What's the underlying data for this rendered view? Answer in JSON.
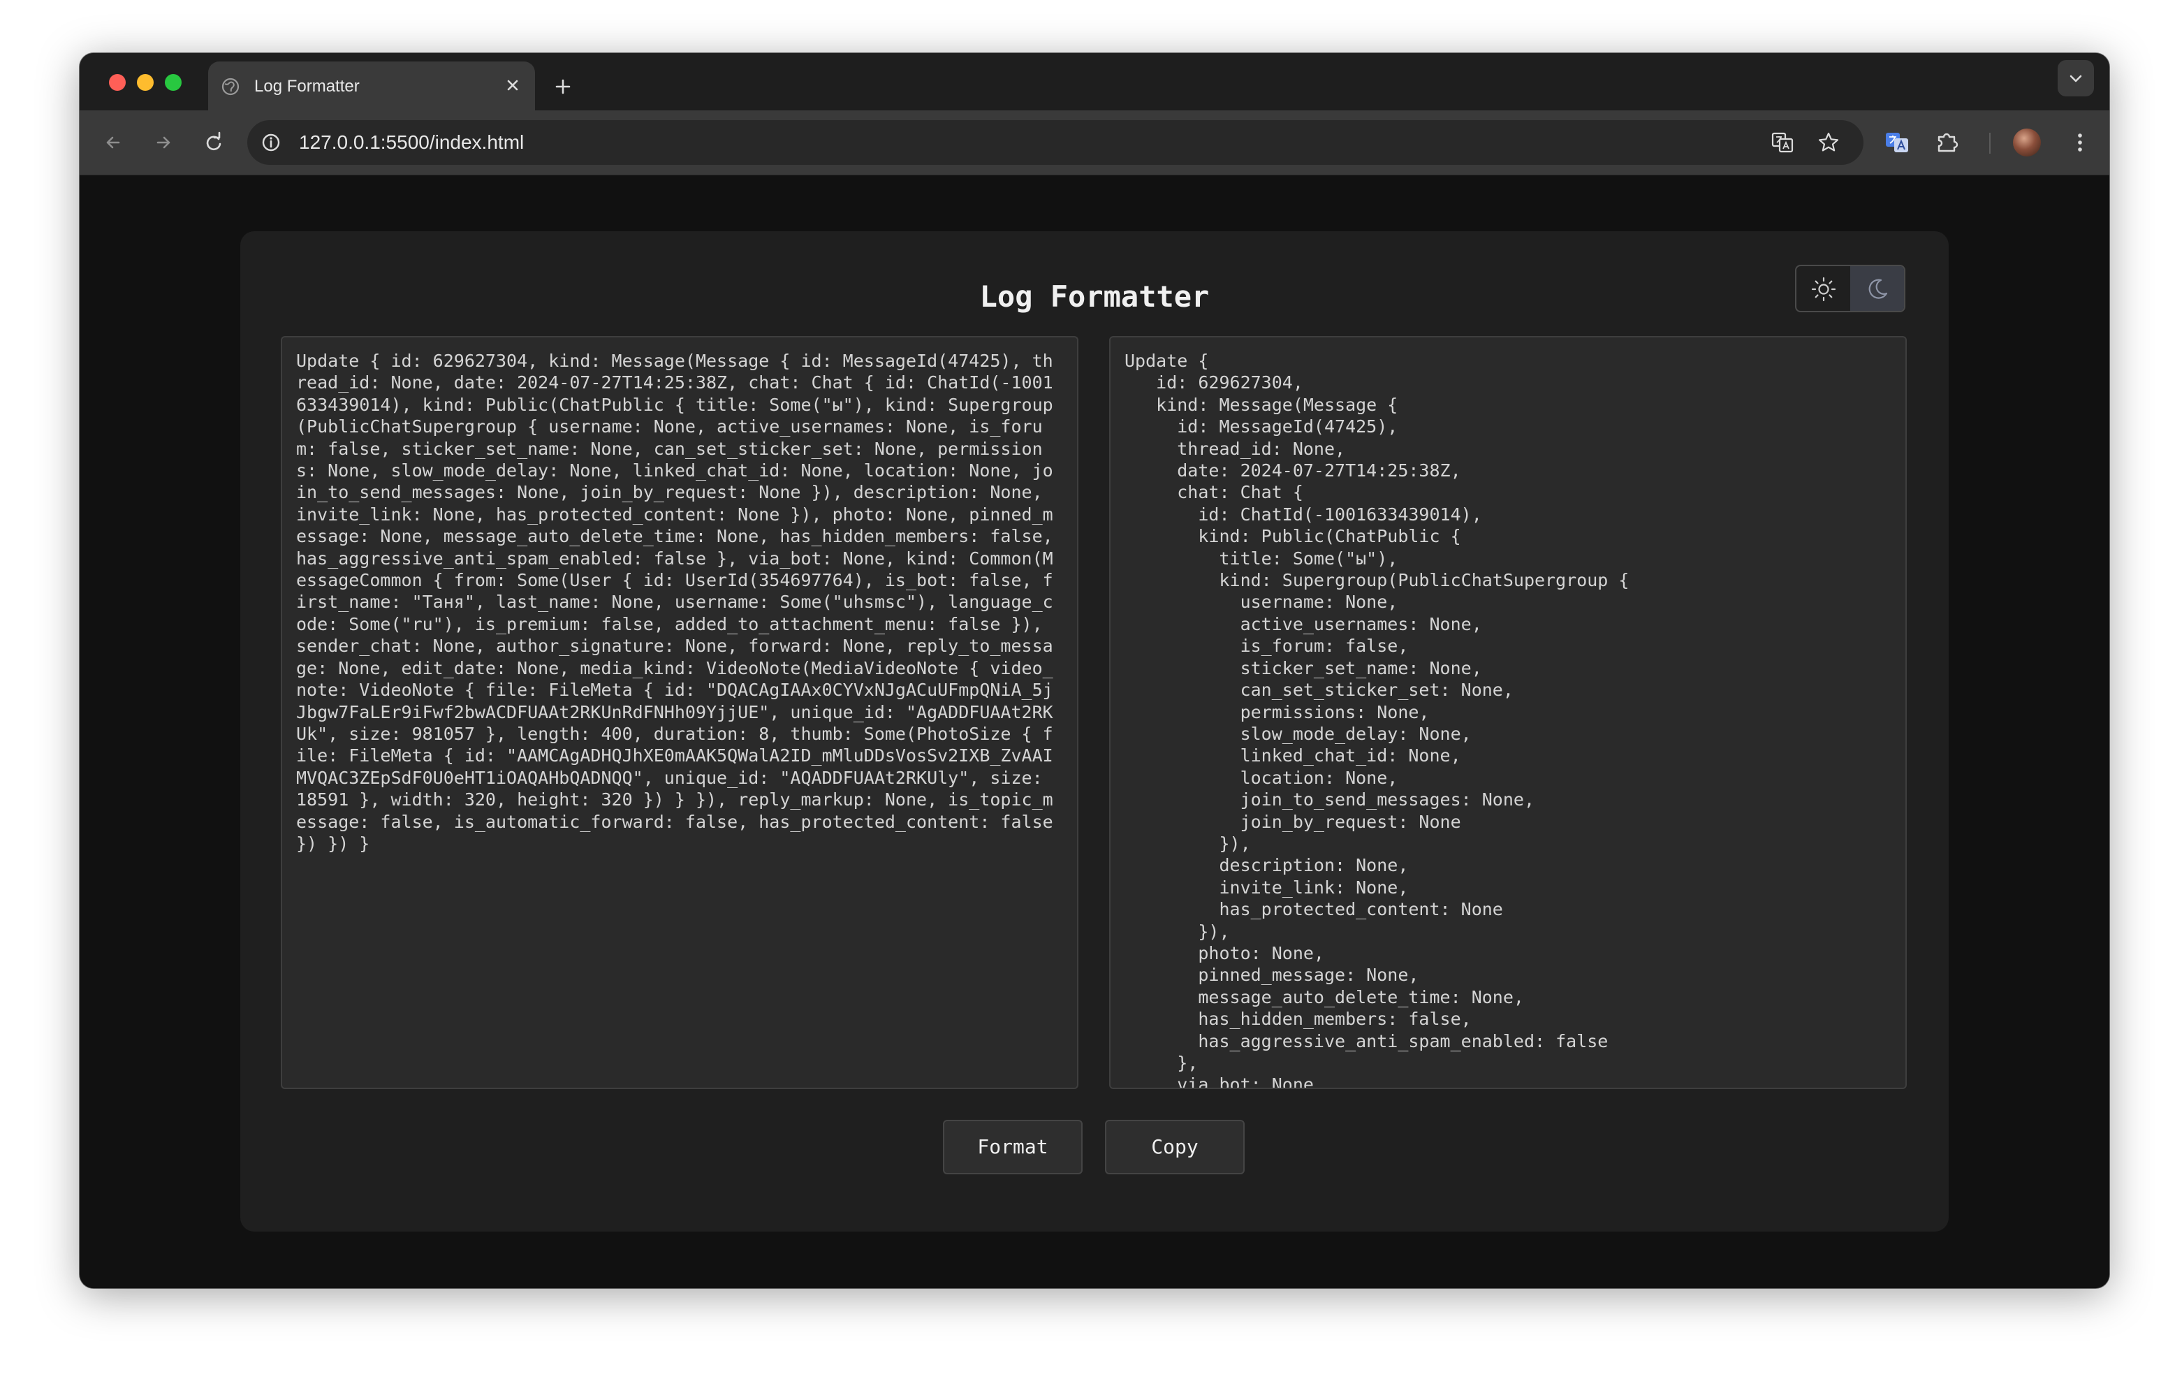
{
  "browser": {
    "tab_title": "Log Formatter",
    "url": "127.0.0.1:5500/index.html"
  },
  "icons": {
    "tab_favicon": "globe-icon",
    "tab_close": "close-icon",
    "new_tab": "plus-icon",
    "tab_dropdown": "chevron-down-icon",
    "back": "arrow-left-icon",
    "forward": "arrow-right-icon",
    "reload": "reload-icon",
    "site_info": "info-icon",
    "translate": "translate-icon",
    "bookmark": "star-icon",
    "translate_extension": "translate-extension-icon",
    "extensions": "puzzle-icon",
    "menu": "kebab-menu-icon",
    "theme_light": "sun-icon",
    "theme_dark": "moon-icon"
  },
  "page": {
    "title": "Log Formatter",
    "theme": "dark"
  },
  "input_log": "Update { id: 629627304, kind: Message(Message { id: MessageId(47425), thread_id: None, date: 2024-07-27T14:25:38Z, chat: Chat { id: ChatId(-1001633439014), kind: Public(ChatPublic { title: Some(\"ы\"), kind: Supergroup(PublicChatSupergroup { username: None, active_usernames: None, is_forum: false, sticker_set_name: None, can_set_sticker_set: None, permissions: None, slow_mode_delay: None, linked_chat_id: None, location: None, join_to_send_messages: None, join_by_request: None }), description: None, invite_link: None, has_protected_content: None }), photo: None, pinned_message: None, message_auto_delete_time: None, has_hidden_members: false, has_aggressive_anti_spam_enabled: false }, via_bot: None, kind: Common(MessageCommon { from: Some(User { id: UserId(354697764), is_bot: false, first_name: \"Таня\", last_name: None, username: Some(\"uhsmsc\"), language_code: Some(\"ru\"), is_premium: false, added_to_attachment_menu: false }), sender_chat: None, author_signature: None, forward: None, reply_to_message: None, edit_date: None, media_kind: VideoNote(MediaVideoNote { video_note: VideoNote { file: FileMeta { id: \"DQACAgIAAx0CYVxNJgACuUFmpQNiA_5jJbgw7FaLEr9iFwf2bwACDFUAAt2RKUnRdFNHh09YjjUE\", unique_id: \"AgADDFUAAt2RKUk\", size: 981057 }, length: 400, duration: 8, thumb: Some(PhotoSize { file: FileMeta { id: \"AAMCAgADHQJhXE0mAAK5QWalA2ID_mMluDDsVosSv2IXB_ZvAAIMVQAC3ZEpSdF0U0eHT1iOAQAHbQADNQQ\", unique_id: \"AQADDFUAAt2RKUly\", size: 18591 }, width: 320, height: 320 }) } }), reply_markup: None, is_topic_message: false, is_automatic_forward: false, has_protected_content: false }) }) }",
  "output_log": "Update {\n   id: 629627304,\n   kind: Message(Message {\n     id: MessageId(47425),\n     thread_id: None,\n     date: 2024-07-27T14:25:38Z,\n     chat: Chat {\n       id: ChatId(-1001633439014),\n       kind: Public(ChatPublic {\n         title: Some(\"ы\"),\n         kind: Supergroup(PublicChatSupergroup {\n           username: None,\n           active_usernames: None,\n           is_forum: false,\n           sticker_set_name: None,\n           can_set_sticker_set: None,\n           permissions: None,\n           slow_mode_delay: None,\n           linked_chat_id: None,\n           location: None,\n           join_to_send_messages: None,\n           join_by_request: None\n         }),\n         description: None,\n         invite_link: None,\n         has_protected_content: None\n       }),\n       photo: None,\n       pinned_message: None,\n       message_auto_delete_time: None,\n       has_hidden_members: false,\n       has_aggressive_anti_spam_enabled: false\n     },\n     via_bot: None,",
  "actions": {
    "format_label": "Format",
    "copy_label": "Copy"
  }
}
